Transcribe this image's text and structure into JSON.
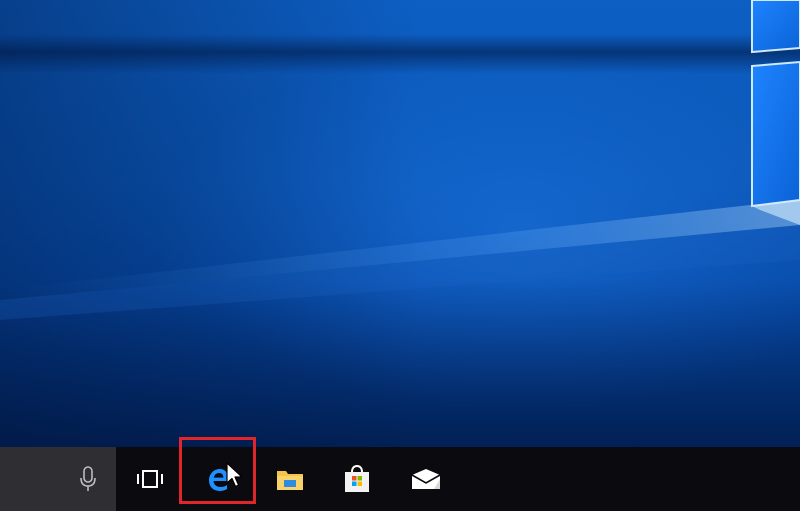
{
  "desktop": {
    "wallpaper": "windows-10-hero-wallpaper",
    "accent_color": "#0a56b6"
  },
  "taskbar": {
    "background": "#0b0b0f",
    "search_box": {
      "icon": "microphone-icon"
    },
    "items": [
      {
        "name": "task-view",
        "icon": "task-view-icon"
      },
      {
        "name": "microsoft-edge",
        "icon": "edge-icon",
        "highlighted": true,
        "highlight_color": "#e0262b"
      },
      {
        "name": "file-explorer",
        "icon": "folder-icon"
      },
      {
        "name": "microsoft-store",
        "icon": "store-icon"
      },
      {
        "name": "mail",
        "icon": "mail-icon"
      }
    ]
  },
  "pointer": {
    "icon": "mouse-cursor-icon",
    "hovering": "microsoft-edge"
  }
}
